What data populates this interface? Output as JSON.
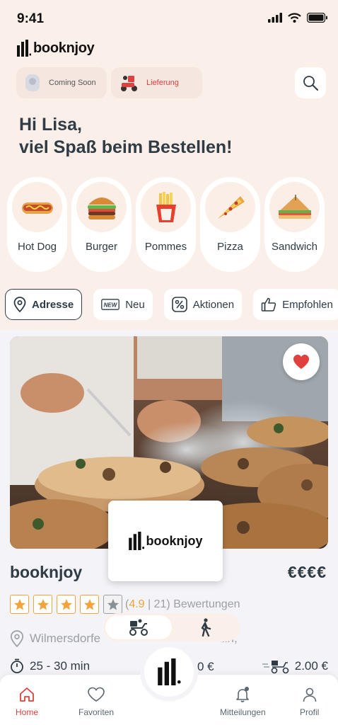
{
  "status": {
    "time": "9:41"
  },
  "brand": {
    "name": "booknjoy",
    "accent": "#e0403e",
    "text_color": "#2f3b45"
  },
  "modes": {
    "coming_soon": "Coming Soon",
    "delivery": "Lieferung"
  },
  "greeting": {
    "line1": "Hi Lisa,",
    "line2": "viel Spaß beim Bestellen!"
  },
  "categories": [
    {
      "label": "Hot Dog",
      "icon": "hotdog-icon"
    },
    {
      "label": "Burger",
      "icon": "burger-icon"
    },
    {
      "label": "Pommes",
      "icon": "fries-icon"
    },
    {
      "label": "Pizza",
      "icon": "pizza-icon"
    },
    {
      "label": "Sandwich",
      "icon": "sandwich-icon"
    }
  ],
  "filters": {
    "address": "Adresse",
    "new": "Neu",
    "new_badge": "NEW",
    "deals": "Aktionen",
    "recommended": "Empfohlen"
  },
  "restaurant": {
    "name": "booknjoy",
    "price_level": "€€€€",
    "stars": 4,
    "rating_open": "(",
    "rating_value": "4.9",
    "rating_rest": " | 21) Bewertungen",
    "address_start": "Wilmersdorfe",
    "address_end": "lin,",
    "delivery_time": "25 - 30 min",
    "min_order_fragment": "0 €",
    "delivery_fee": "2.00 €"
  },
  "nav": {
    "home": "Home",
    "favorites": "Favoriten",
    "notifications": "Mitteilungen",
    "profile": "Profil"
  }
}
